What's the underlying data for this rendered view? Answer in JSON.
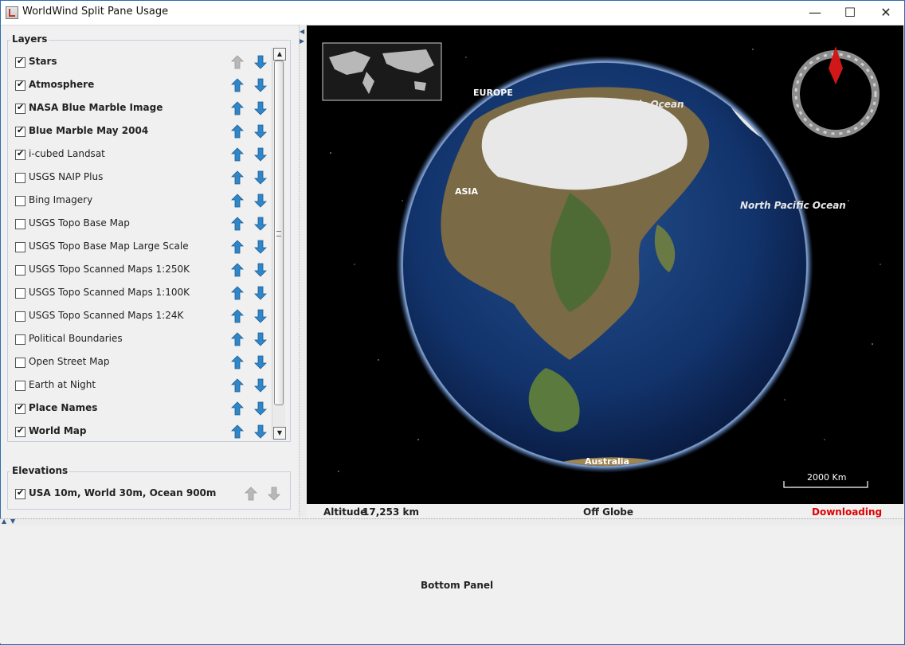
{
  "window": {
    "title": "WorldWind Split Pane Usage",
    "minimize_glyph": "—",
    "maximize_glyph": "☐",
    "close_glyph": "✕"
  },
  "layers_panel": {
    "title": "Layers",
    "items": [
      {
        "label": "Stars",
        "checked": true,
        "bold": true,
        "up_enabled": false,
        "down_enabled": true
      },
      {
        "label": "Atmosphere",
        "checked": true,
        "bold": true,
        "up_enabled": true,
        "down_enabled": true
      },
      {
        "label": "NASA Blue Marble Image",
        "checked": true,
        "bold": true,
        "up_enabled": true,
        "down_enabled": true
      },
      {
        "label": "Blue Marble May 2004",
        "checked": true,
        "bold": true,
        "up_enabled": true,
        "down_enabled": true
      },
      {
        "label": "i-cubed Landsat",
        "checked": true,
        "bold": false,
        "up_enabled": true,
        "down_enabled": true
      },
      {
        "label": "USGS NAIP Plus",
        "checked": false,
        "bold": false,
        "up_enabled": true,
        "down_enabled": true
      },
      {
        "label": "Bing Imagery",
        "checked": false,
        "bold": false,
        "up_enabled": true,
        "down_enabled": true
      },
      {
        "label": "USGS Topo Base Map",
        "checked": false,
        "bold": false,
        "up_enabled": true,
        "down_enabled": true
      },
      {
        "label": "USGS Topo Base Map Large Scale",
        "checked": false,
        "bold": false,
        "up_enabled": true,
        "down_enabled": true
      },
      {
        "label": "USGS Topo Scanned Maps 1:250K",
        "checked": false,
        "bold": false,
        "up_enabled": true,
        "down_enabled": true
      },
      {
        "label": "USGS Topo Scanned Maps 1:100K",
        "checked": false,
        "bold": false,
        "up_enabled": true,
        "down_enabled": true
      },
      {
        "label": "USGS Topo Scanned Maps 1:24K",
        "checked": false,
        "bold": false,
        "up_enabled": true,
        "down_enabled": true
      },
      {
        "label": "Political Boundaries",
        "checked": false,
        "bold": false,
        "up_enabled": true,
        "down_enabled": true
      },
      {
        "label": "Open Street Map",
        "checked": false,
        "bold": false,
        "up_enabled": true,
        "down_enabled": true
      },
      {
        "label": "Earth at Night",
        "checked": false,
        "bold": false,
        "up_enabled": true,
        "down_enabled": true
      },
      {
        "label": "Place Names",
        "checked": true,
        "bold": true,
        "up_enabled": true,
        "down_enabled": true
      },
      {
        "label": "World Map",
        "checked": true,
        "bold": true,
        "up_enabled": true,
        "down_enabled": true
      }
    ]
  },
  "elevations_panel": {
    "title": "Elevations",
    "items": [
      {
        "label": "USA 10m, World 30m, Ocean 900m",
        "checked": true,
        "bold": true,
        "up_enabled": false,
        "down_enabled": false
      }
    ]
  },
  "globe": {
    "labels": {
      "europe": "EUROPE",
      "asia": "ASIA",
      "arctic": "Arctic Ocean",
      "north_pacific": "North Pacific Ocean",
      "australia": "Australia"
    },
    "scale_bar": "2000 Km"
  },
  "status": {
    "altitude_label": "Altitude",
    "altitude_value": "17,253 km",
    "position": "Off Globe",
    "downloading": "Downloading"
  },
  "bottom_panel": {
    "label": "Bottom Panel"
  },
  "colors": {
    "arrow_enabled": "#2f86c9",
    "arrow_disabled": "#b8b8b8",
    "downloading": "#e00000",
    "compass_needle": "#d01818"
  }
}
